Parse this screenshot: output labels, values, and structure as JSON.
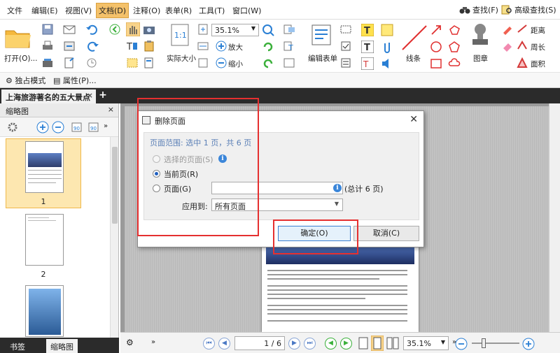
{
  "menu": {
    "items": [
      "文件",
      "编辑(E)",
      "视图(V)",
      "文档(D)",
      "注释(O)",
      "表单(R)",
      "工具(T)",
      "窗口(W)"
    ],
    "find": "查找(F)",
    "advanced_find": "高级查找(S)"
  },
  "ribbon": {
    "open": "打开(O)...",
    "actual_size": "实际大小",
    "zoom_value": "35.1%",
    "zoom_in": "放大",
    "zoom_out": "缩小",
    "edit_form": "编辑表单",
    "line": "线条",
    "stamp": "图章",
    "distance": "距离",
    "perimeter": "周长",
    "area": "面积",
    "standalone": "独占模式",
    "properties": "属性(P)..."
  },
  "tab": {
    "title": "上海旅游著名的五大景点",
    "close": "×",
    "add": "+"
  },
  "sidebar": {
    "header": "缩略图",
    "close": "×",
    "pages": [
      "1",
      "2"
    ],
    "bottom_tabs": [
      "书签",
      "缩略图"
    ]
  },
  "dialog": {
    "title": "删除页面",
    "close": "✕",
    "range_label": "页面范围:",
    "range_value": "选中 1 页，共 6 页",
    "opt_selected": "选择的页面(S)",
    "opt_current": "当前页(R)",
    "opt_pages": "页面(G)",
    "total": "(总计 6 页)",
    "apply_to_label": "应用到:",
    "apply_to_value": "所有页面",
    "ok": "确定(O)",
    "cancel": "取消(C)"
  },
  "status": {
    "page": "1 / 6",
    "zoom": "35.1%"
  },
  "colors": {
    "highlight": "#e53030",
    "active_menu": "#f4c16a",
    "selected_thumb": "#fde7b0"
  }
}
